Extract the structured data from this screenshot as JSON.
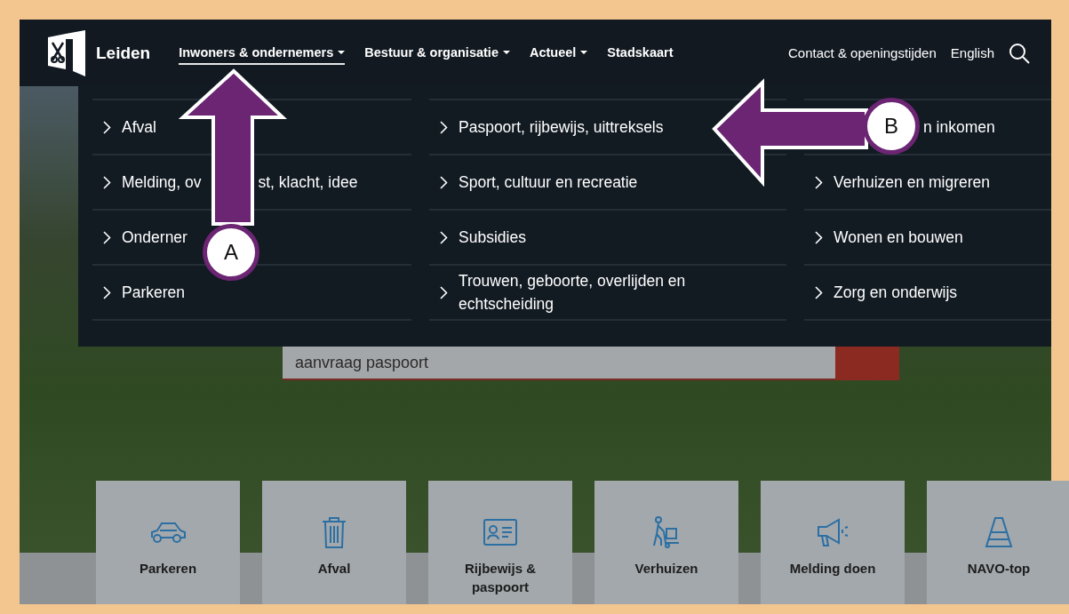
{
  "header": {
    "logo_text": "Leiden",
    "nav": [
      {
        "label": "Inwoners & ondernemers",
        "has_menu": true,
        "selected": true
      },
      {
        "label": "Bestuur & organisatie",
        "has_menu": true,
        "selected": false
      },
      {
        "label": "Actueel",
        "has_menu": true,
        "selected": false
      },
      {
        "label": "Stadskaart",
        "has_menu": false,
        "selected": false
      }
    ],
    "utility": [
      "Contact & openingstijden",
      "English"
    ]
  },
  "dropdown": {
    "columns": [
      [
        {
          "parts": [
            "Afval"
          ],
          "covered_start": false
        },
        {
          "parts": [
            "Melding, ov",
            "st, klacht, idee"
          ],
          "covered_start": false
        },
        {
          "parts": [
            "Onderner"
          ],
          "covered_start": false
        },
        {
          "parts": [
            "Parkeren"
          ],
          "covered_start": false
        }
      ],
      [
        {
          "parts": [
            "Paspoort, rijbewijs, uittreksels"
          ],
          "covered_start": false
        },
        {
          "parts": [
            "Sport, cultuur en recreatie"
          ],
          "covered_start": false
        },
        {
          "parts": [
            "Subsidies"
          ],
          "covered_start": false
        },
        {
          "parts": [
            "Trouwen, geboorte, overlijden en echtscheiding"
          ],
          "covered_start": false
        }
      ],
      [
        {
          "parts": [
            "n inkomen"
          ],
          "covered_start": true
        },
        {
          "parts": [
            "Verhuizen en migreren"
          ],
          "covered_start": false
        },
        {
          "parts": [
            "Wonen en bouwen"
          ],
          "covered_start": false
        },
        {
          "parts": [
            "Zorg en onderwijs"
          ],
          "covered_start": false
        }
      ]
    ]
  },
  "search": {
    "value": "aanvraag paspoort"
  },
  "tiles": [
    {
      "label": "Parkeren",
      "kind": "car"
    },
    {
      "label": "Afval",
      "kind": "bin"
    },
    {
      "label": "Rijbewijs & paspoort",
      "kind": "card"
    },
    {
      "label": "Verhuizen",
      "kind": "mover"
    },
    {
      "label": "Melding doen",
      "kind": "megaphone"
    },
    {
      "label": "NAVO-top",
      "kind": "cone"
    }
  ],
  "annotations": [
    {
      "label": "A",
      "kind": "up"
    },
    {
      "label": "B",
      "kind": "left"
    }
  ]
}
